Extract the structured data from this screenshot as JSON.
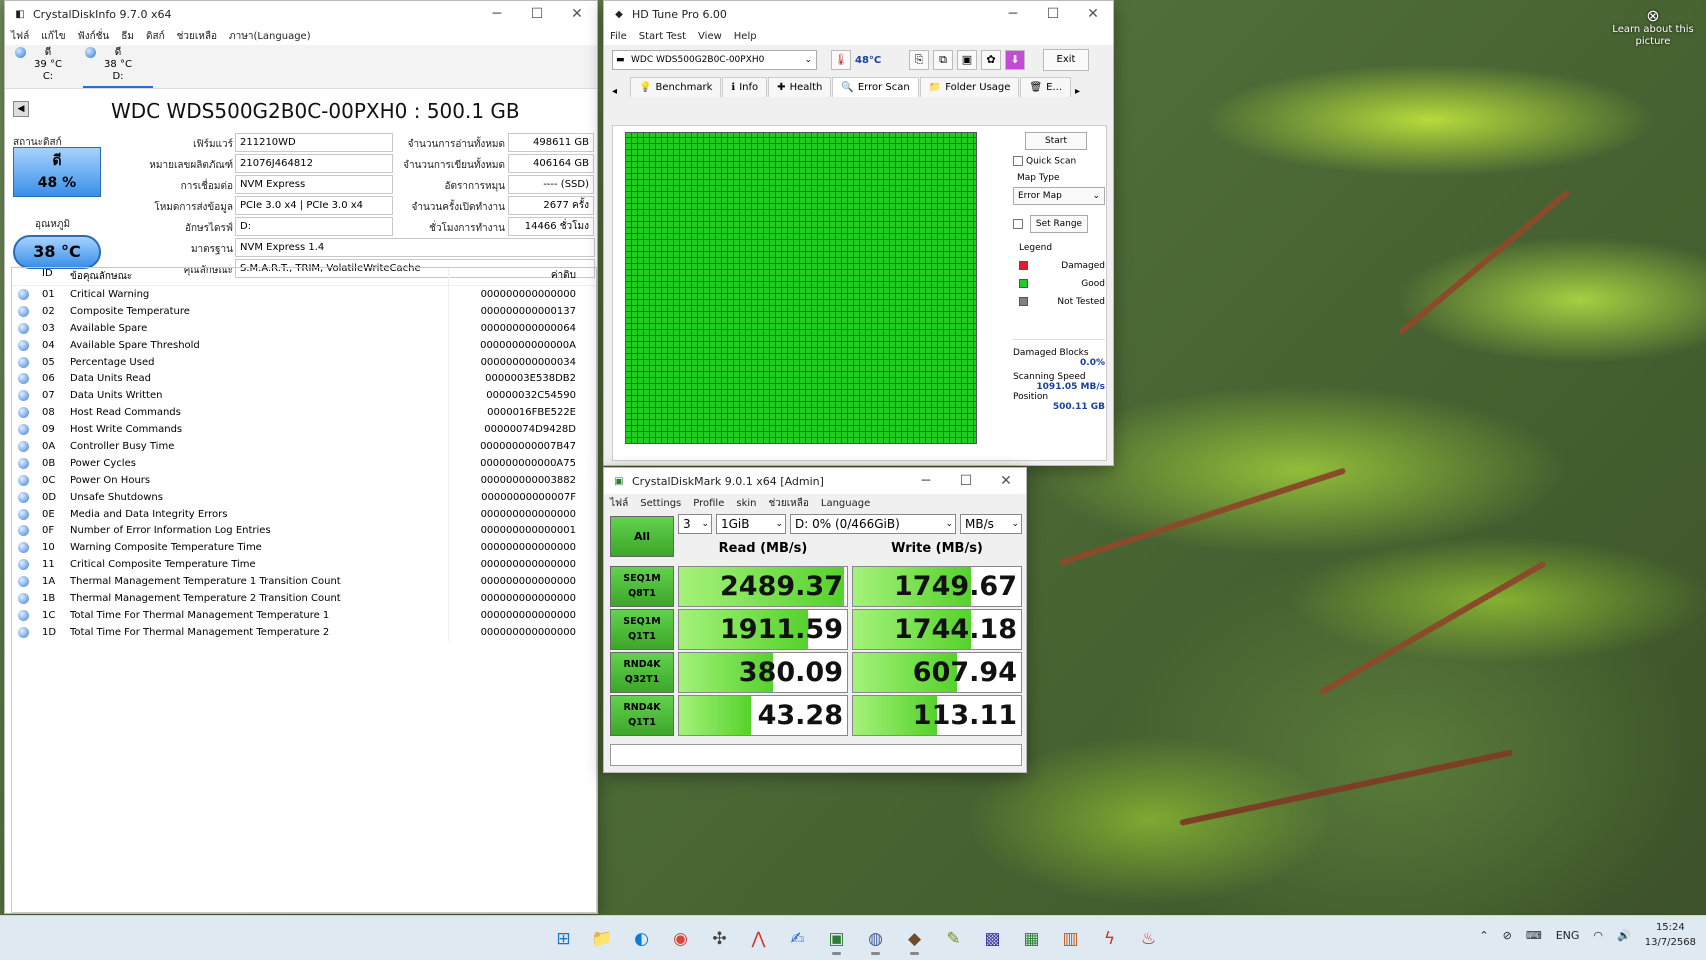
{
  "desktop": {
    "learn_icon": "⊗",
    "learn_text": "Learn about this picture"
  },
  "cdi": {
    "title": "CrystalDiskInfo 9.7.0 x64",
    "menu": [
      "ไฟล์",
      "แก้ไข",
      "ฟังก์ชั่น",
      "ธีม",
      "ดิสก์",
      "ช่วยเหลือ",
      "ภาษา(Language)"
    ],
    "drives": [
      {
        "status": "ดี",
        "temp": "39 °C",
        "letter": "C:"
      },
      {
        "status": "ดี",
        "temp": "38 °C",
        "letter": "D:"
      }
    ],
    "model": "WDC WDS500G2B0C-00PXH0 : 500.1 GB",
    "health_label": "สถานะดิสก์",
    "health_status": "ดี",
    "health_percent": "48 %",
    "temp_label": "อุณหภูมิ",
    "temp_value": "38 °C",
    "fields": {
      "firmware_label": "เฟิร์มแวร์",
      "firmware": "211210WD",
      "serial_label": "หมายเลขผลิตภัณฑ์",
      "serial": "21076J464812",
      "interface_label": "การเชื่อมต่อ",
      "interface": "NVM Express",
      "transfer_label": "โหมดการส่งข้อมูล",
      "transfer": "PCIe 3.0 x4 | PCIe 3.0 x4",
      "letter_label": "อักษรไดรฟ์",
      "letter": "D:",
      "standard_label": "มาตรฐาน",
      "standard": "NVM Express 1.4",
      "features_label": "คุณลักษณะ",
      "features": "S.M.A.R.T., TRIM, VolatileWriteCache",
      "reads_label": "จำนวนการอ่านทั้งหมด",
      "reads": "498611 GB",
      "writes_label": "จำนวนการเขียนทั้งหมด",
      "writes": "406164 GB",
      "rotation_label": "อัตราการหมุน",
      "rotation": "---- (SSD)",
      "poweron_count_label": "จำนวนครั้งเปิดทำงาน",
      "poweron_count": "2677 ครั้ง",
      "poweron_hours_label": "ชั่วโมงการทำงาน",
      "poweron_hours": "14466 ชั่วโมง"
    },
    "smart_headers": {
      "id": "ID",
      "attr": "ข้อคุณลักษณะ",
      "raw": "ค่าดิบ"
    },
    "smart_rows": [
      {
        "id": "01",
        "name": "Critical Warning",
        "raw": "000000000000000"
      },
      {
        "id": "02",
        "name": "Composite Temperature",
        "raw": "000000000000137"
      },
      {
        "id": "03",
        "name": "Available Spare",
        "raw": "000000000000064"
      },
      {
        "id": "04",
        "name": "Available Spare Threshold",
        "raw": "00000000000000A"
      },
      {
        "id": "05",
        "name": "Percentage Used",
        "raw": "000000000000034"
      },
      {
        "id": "06",
        "name": "Data Units Read",
        "raw": "0000003E538DB2"
      },
      {
        "id": "07",
        "name": "Data Units Written",
        "raw": "00000032C54590"
      },
      {
        "id": "08",
        "name": "Host Read Commands",
        "raw": "0000016FBE522E"
      },
      {
        "id": "09",
        "name": "Host Write Commands",
        "raw": "00000074D9428D"
      },
      {
        "id": "0A",
        "name": "Controller Busy Time",
        "raw": "000000000007B47"
      },
      {
        "id": "0B",
        "name": "Power Cycles",
        "raw": "000000000000A75"
      },
      {
        "id": "0C",
        "name": "Power On Hours",
        "raw": "000000000003882"
      },
      {
        "id": "0D",
        "name": "Unsafe Shutdowns",
        "raw": "00000000000007F"
      },
      {
        "id": "0E",
        "name": "Media and Data Integrity Errors",
        "raw": "000000000000000"
      },
      {
        "id": "0F",
        "name": "Number of Error Information Log Entries",
        "raw": "000000000000001"
      },
      {
        "id": "10",
        "name": "Warning Composite Temperature Time",
        "raw": "000000000000000"
      },
      {
        "id": "11",
        "name": "Critical Composite Temperature Time",
        "raw": "000000000000000"
      },
      {
        "id": "1A",
        "name": "Thermal Management Temperature 1 Transition Count",
        "raw": "000000000000000"
      },
      {
        "id": "1B",
        "name": "Thermal Management Temperature 2 Transition Count",
        "raw": "000000000000000"
      },
      {
        "id": "1C",
        "name": "Total Time For Thermal Management Temperature 1",
        "raw": "000000000000000"
      },
      {
        "id": "1D",
        "name": "Total Time For Thermal Management Temperature 2",
        "raw": "000000000000000"
      }
    ]
  },
  "hdt": {
    "title": "HD Tune Pro 6.00",
    "menu": [
      "File",
      "Start Test",
      "View",
      "Help"
    ],
    "drive": "WDC WDS500G2B0C-00PXH0",
    "temp": "48°C",
    "exit": "Exit",
    "tabs": [
      {
        "label": "Benchmark",
        "icon": "💡"
      },
      {
        "label": "Info",
        "icon": "ℹ"
      },
      {
        "label": "Health",
        "icon": "✚"
      },
      {
        "label": "Error Scan",
        "icon": "🔍"
      },
      {
        "label": "Folder Usage",
        "icon": "📁"
      },
      {
        "label": "E...",
        "icon": "🗑"
      }
    ],
    "start": "Start",
    "quick_scan": "Quick Scan",
    "map_type_label": "Map Type",
    "map_type": "Error Map",
    "set_range": "Set Range",
    "legend_label": "Legend",
    "legend": [
      {
        "label": "Damaged",
        "color": "#e02020"
      },
      {
        "label": "Good",
        "color": "#22cc22"
      },
      {
        "label": "Not Tested",
        "color": "#808080"
      }
    ],
    "damaged_blocks_label": "Damaged Blocks",
    "damaged_blocks": "0.0%",
    "scan_speed_label": "Scanning Speed",
    "scan_speed": "1091.05 MB/s",
    "position_label": "Position",
    "position": "500.11 GB"
  },
  "cdm": {
    "title": "CrystalDiskMark 9.0.1 x64 [Admin]",
    "menu": [
      "ไฟล์",
      "Settings",
      "Profile",
      "skin",
      "ช่วยเหลือ",
      "Language"
    ],
    "all": "All",
    "count": "3",
    "size": "1GiB",
    "drive": "D: 0% (0/466GiB)",
    "unit": "MB/s",
    "read_header": "Read (MB/s)",
    "write_header": "Write (MB/s)",
    "rows": [
      {
        "l1": "SEQ1M",
        "l2": "Q8T1",
        "read": "2489.37",
        "write": "1749.67",
        "read_frac": 0.98,
        "write_frac": 0.7
      },
      {
        "l1": "SEQ1M",
        "l2": "Q1T1",
        "read": "1911.59",
        "write": "1744.18",
        "read_frac": 0.77,
        "write_frac": 0.7
      },
      {
        "l1": "RND4K",
        "l2": "Q32T1",
        "read": "380.09",
        "write": "607.94",
        "read_frac": 0.56,
        "write_frac": 0.62
      },
      {
        "l1": "RND4K",
        "l2": "Q1T1",
        "read": "43.28",
        "write": "113.11",
        "read_frac": 0.43,
        "write_frac": 0.5
      }
    ]
  },
  "taskbar": {
    "apps": [
      {
        "name": "start-icon",
        "glyph": "⊞",
        "color": "#1976d2"
      },
      {
        "name": "file-explorer-icon",
        "glyph": "📁",
        "color": "#e9a800"
      },
      {
        "name": "edge-icon",
        "glyph": "◐",
        "color": "#0f7bd8"
      },
      {
        "name": "chrome-icon",
        "glyph": "◉",
        "color": "#db4437"
      },
      {
        "name": "app-icon",
        "glyph": "✣",
        "color": "#444"
      },
      {
        "name": "acrobat-icon",
        "glyph": "⋀",
        "color": "#d32f2f"
      },
      {
        "name": "app-icon",
        "glyph": "✍",
        "color": "#2b6cd4"
      },
      {
        "name": "crystaldiskinfo-icon",
        "glyph": "▣",
        "color": "#2e7d32"
      },
      {
        "name": "crystaldiskmark-icon",
        "glyph": "◍",
        "color": "#455a9c"
      },
      {
        "name": "hdtune-icon",
        "glyph": "◆",
        "color": "#6d4c2f"
      },
      {
        "name": "app-icon",
        "glyph": "✎",
        "color": "#7a8c1f"
      },
      {
        "name": "app-icon",
        "glyph": "▩",
        "color": "#3f3a9c"
      },
      {
        "name": "app-icon",
        "glyph": "▦",
        "color": "#2e7d32"
      },
      {
        "name": "app-icon",
        "glyph": "▥",
        "color": "#c05a1a"
      },
      {
        "name": "app-icon",
        "glyph": "ϟ",
        "color": "#d32f2f"
      },
      {
        "name": "app-icon",
        "glyph": "♨",
        "color": "#c62828"
      }
    ],
    "lang": "ENG",
    "time": "15:24",
    "date": "13/7/2568"
  }
}
